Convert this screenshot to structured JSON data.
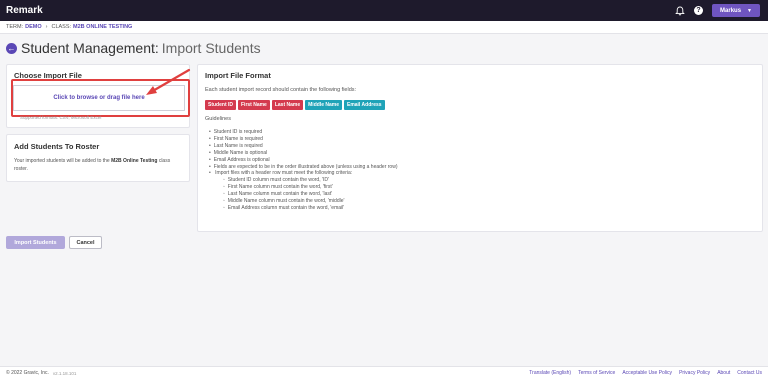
{
  "app": {
    "brand": "Remark"
  },
  "topbar": {
    "user_label": "Markus"
  },
  "context": {
    "term_label": "TERM:",
    "term_value": "DEMO",
    "separator": "›",
    "class_label": "CLASS:",
    "class_value": "M2B ONLINE TESTING"
  },
  "page": {
    "title_main": "Student Management:",
    "title_sub": "Import Students"
  },
  "import_card": {
    "heading": "Choose Import File",
    "dropzone_label": "Click to browse or drag file here",
    "supported_formats": "Supported formats: CSV, Microsoft Excel"
  },
  "roster_card": {
    "heading": "Add Students To Roster",
    "text_before": "Your imported students will be added to the",
    "class_name": "M2B Online Testing",
    "text_after": "class roster."
  },
  "format_card": {
    "heading": "Import File Format",
    "intro": "Each student import record should contain the following fields:",
    "fields": [
      {
        "label": "Student ID",
        "color": "#d43a4e"
      },
      {
        "label": "First Name",
        "color": "#d43a4e"
      },
      {
        "label": "Last Name",
        "color": "#d43a4e"
      },
      {
        "label": "Middle Name",
        "color": "#1fa3b8"
      },
      {
        "label": "Email Address",
        "color": "#1fa3b8"
      }
    ],
    "guidelines_label": "Guidelines",
    "rules": [
      "Student ID is required",
      "First Name is required",
      "Last Name is required",
      "Middle Name is optional",
      "Email Address is optional",
      "Fields are expected to be in the order illustrated above (unless using a header row)",
      "Import files with a header row must meet the following criteria:"
    ],
    "header_rules": [
      "Student ID column must contain the word, 'ID'",
      "First Name column must contain the word, 'first'",
      "Last Name column must contain the word, 'last'",
      "Middle Name column must contain the word, 'middle'",
      "Email Address column must contain the word, 'email'"
    ]
  },
  "buttons": {
    "import": "Import Students",
    "cancel": "Cancel"
  },
  "footer": {
    "copyright": "© 2022 Gravic, Inc.",
    "version": "v2.1.18.101",
    "links": [
      "Translate (English)",
      "Terms of Service",
      "Acceptable Use Policy",
      "Privacy Policy",
      "About",
      "Contact Us"
    ]
  },
  "colors": {
    "accent": "#5a47b5",
    "topbar": "#1e1a2c",
    "highlight": "#e0403f"
  }
}
